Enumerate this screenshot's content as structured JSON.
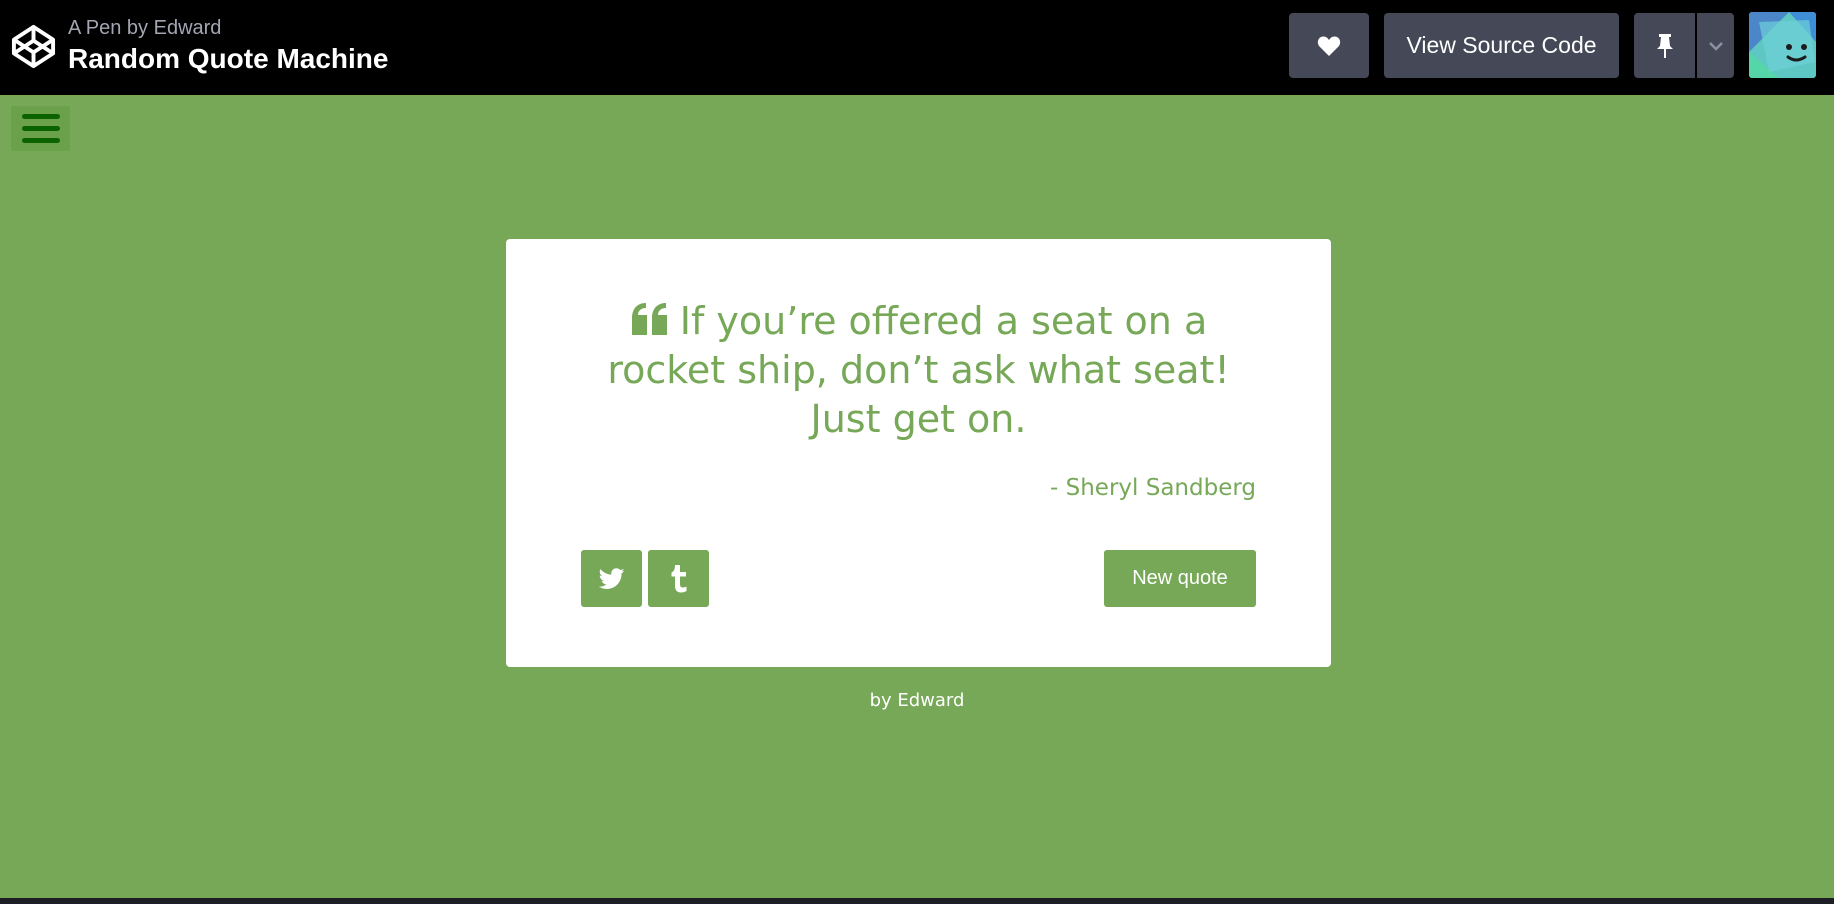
{
  "header": {
    "subtitle": "A Pen by Edward",
    "title": "Random Quote Machine",
    "view_source_label": "View Source Code",
    "icons": {
      "logo": "codepen-logo-icon",
      "like": "heart-icon",
      "pin": "pin-icon",
      "more": "chevron-down-icon"
    }
  },
  "quote": {
    "text": "If you’re offered a seat on a rocket ship, don’t ask what seat! Just get on.",
    "author": "- Sheryl Sandberg",
    "new_quote_label": "New quote",
    "share_icons": [
      "twitter-icon",
      "tumblr-icon"
    ]
  },
  "footer": {
    "by": "by ",
    "author": "Edward"
  },
  "colors": {
    "accent": "#76a858",
    "topbar": "#000000",
    "button_dark": "#444857",
    "menu_icon": "#0b6300"
  }
}
